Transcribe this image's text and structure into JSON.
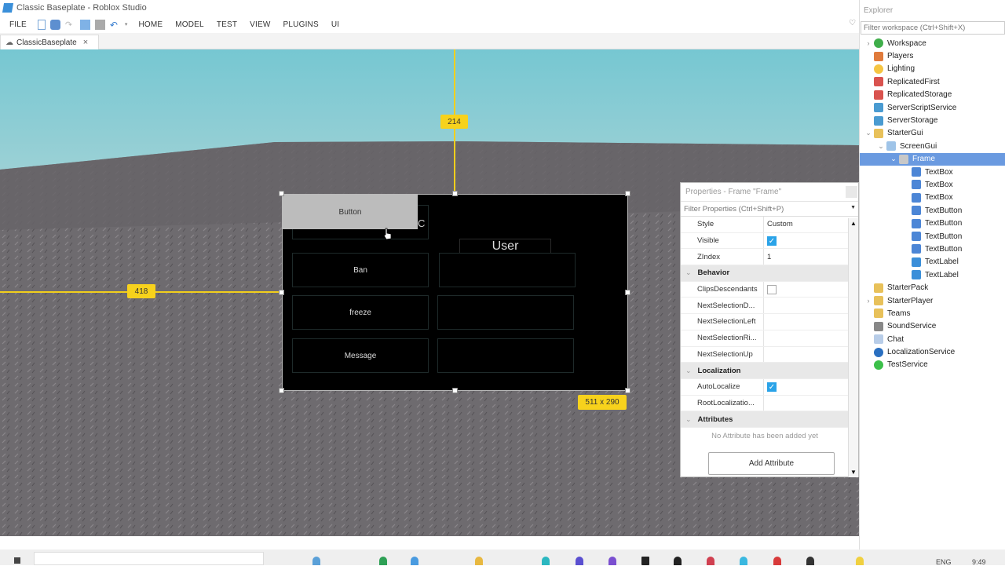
{
  "window": {
    "title": "Classic Baseplate - Roblox Studio"
  },
  "menubar": {
    "file": "FILE",
    "quick_access_icons": [
      "new-file-icon",
      "find-icon",
      "redo-icon",
      "publish-icon",
      "stop-icon",
      "undo-icon",
      "customize-dropdown-icon"
    ],
    "tabs": [
      "HOME",
      "MODEL",
      "TEST",
      "VIEW",
      "PLUGINS",
      "UI"
    ]
  },
  "document_tabs": [
    {
      "label": "ClassicBaseplate",
      "icon": "cloud-icon",
      "close": "×"
    }
  ],
  "viewport": {
    "guides": {
      "top_distance": "214",
      "left_distance": "418",
      "size": "511 x 290"
    },
    "gui": {
      "top_button": "Button",
      "partial_text": "C",
      "user_label": "User",
      "buttons": [
        "Ban",
        "freeze",
        "Message"
      ]
    }
  },
  "explorer": {
    "title": "Explorer",
    "filter_placeholder": "Filter workspace (Ctrl+Shift+X)",
    "items": [
      {
        "label": "Workspace",
        "icon": "workspace-icon",
        "color": "#3fae4a",
        "depth": 0,
        "chev": "›"
      },
      {
        "label": "Players",
        "icon": "players-icon",
        "color": "#e07b3c",
        "depth": 0,
        "chev": ""
      },
      {
        "label": "Lighting",
        "icon": "lighting-icon",
        "color": "#f5c542",
        "depth": 0,
        "chev": ""
      },
      {
        "label": "ReplicatedFirst",
        "icon": "replicated-first-icon",
        "color": "#d9534f",
        "depth": 0,
        "chev": ""
      },
      {
        "label": "ReplicatedStorage",
        "icon": "replicated-storage-icon",
        "color": "#d9534f",
        "depth": 0,
        "chev": ""
      },
      {
        "label": "ServerScriptService",
        "icon": "server-script-service-icon",
        "color": "#4a9bd1",
        "depth": 0,
        "chev": ""
      },
      {
        "label": "ServerStorage",
        "icon": "server-storage-icon",
        "color": "#4a9bd1",
        "depth": 0,
        "chev": ""
      },
      {
        "label": "StarterGui",
        "icon": "starter-gui-icon",
        "color": "#e8c15a",
        "depth": 0,
        "chev": "⌄"
      },
      {
        "label": "ScreenGui",
        "icon": "screen-gui-icon",
        "color": "#9fc4e8",
        "depth": 1,
        "chev": "⌄"
      },
      {
        "label": "Frame",
        "icon": "frame-icon",
        "color": "#c8c8c8",
        "depth": 2,
        "chev": "⌄",
        "selected": true
      },
      {
        "label": "TextBox",
        "icon": "textbox-icon",
        "color": "#4c86d6",
        "depth": 3,
        "chev": ""
      },
      {
        "label": "TextBox",
        "icon": "textbox-icon",
        "color": "#4c86d6",
        "depth": 3,
        "chev": ""
      },
      {
        "label": "TextBox",
        "icon": "textbox-icon",
        "color": "#4c86d6",
        "depth": 3,
        "chev": ""
      },
      {
        "label": "TextButton",
        "icon": "textbutton-icon",
        "color": "#4c86d6",
        "depth": 3,
        "chev": ""
      },
      {
        "label": "TextButton",
        "icon": "textbutton-icon",
        "color": "#4c86d6",
        "depth": 3,
        "chev": ""
      },
      {
        "label": "TextButton",
        "icon": "textbutton-icon",
        "color": "#4c86d6",
        "depth": 3,
        "chev": ""
      },
      {
        "label": "TextButton",
        "icon": "textbutton-icon",
        "color": "#4c86d6",
        "depth": 3,
        "chev": ""
      },
      {
        "label": "TextLabel",
        "icon": "textlabel-icon",
        "color": "#3b8fd9",
        "depth": 3,
        "chev": ""
      },
      {
        "label": "TextLabel",
        "icon": "textlabel-icon",
        "color": "#3b8fd9",
        "depth": 3,
        "chev": ""
      },
      {
        "label": "StarterPack",
        "icon": "starter-pack-icon",
        "color": "#e8c15a",
        "depth": 0,
        "chev": ""
      },
      {
        "label": "StarterPlayer",
        "icon": "starter-player-icon",
        "color": "#e8c15a",
        "depth": 0,
        "chev": "›"
      },
      {
        "label": "Teams",
        "icon": "teams-icon",
        "color": "#e8c15a",
        "depth": 0,
        "chev": ""
      },
      {
        "label": "SoundService",
        "icon": "sound-service-icon",
        "color": "#888888",
        "depth": 0,
        "chev": ""
      },
      {
        "label": "Chat",
        "icon": "chat-icon",
        "color": "#b8cde8",
        "depth": 0,
        "chev": ""
      },
      {
        "label": "LocalizationService",
        "icon": "localization-service-icon",
        "color": "#2a6fc0",
        "depth": 0,
        "chev": ""
      },
      {
        "label": "TestService",
        "icon": "test-service-icon",
        "color": "#3cc04a",
        "depth": 0,
        "chev": ""
      }
    ]
  },
  "properties": {
    "title": "Properties - Frame \"Frame\"",
    "filter_placeholder": "Filter Properties (Ctrl+Shift+P)",
    "rows": [
      {
        "type": "prop",
        "key": "Style",
        "value": "Custom"
      },
      {
        "type": "prop",
        "key": "Visible",
        "checkbox": true
      },
      {
        "type": "prop",
        "key": "ZIndex",
        "value": "1"
      },
      {
        "type": "section",
        "key": "Behavior"
      },
      {
        "type": "prop",
        "key": "ClipsDescendants",
        "checkbox": false
      },
      {
        "type": "prop",
        "key": "NextSelectionD...",
        "value": ""
      },
      {
        "type": "prop",
        "key": "NextSelectionLeft",
        "value": ""
      },
      {
        "type": "prop",
        "key": "NextSelectionRi...",
        "value": ""
      },
      {
        "type": "prop",
        "key": "NextSelectionUp",
        "value": ""
      },
      {
        "type": "section",
        "key": "Localization"
      },
      {
        "type": "prop",
        "key": "AutoLocalize",
        "checkbox": true
      },
      {
        "type": "prop",
        "key": "RootLocalizatio...",
        "value": ""
      },
      {
        "type": "section",
        "key": "Attributes"
      },
      {
        "type": "note",
        "key": "No Attribute has been added yet"
      }
    ],
    "add_attribute": "Add Attribute"
  },
  "taskbar": {
    "language": "ENG",
    "time": "9:49"
  }
}
